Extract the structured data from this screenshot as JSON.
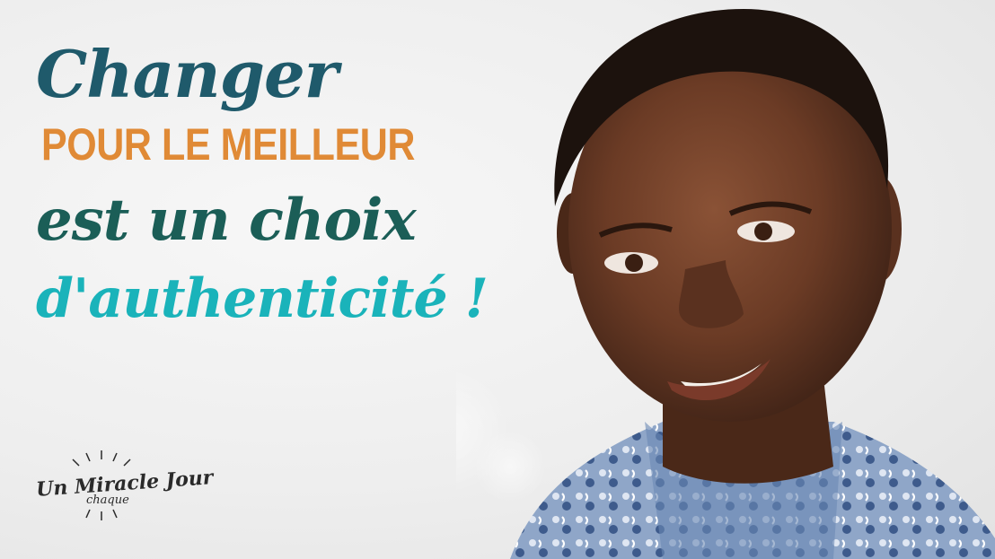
{
  "headline": {
    "line1": "Changer",
    "line2": "POUR LE MEILLEUR",
    "line3": "est un choix",
    "line4": "d'authenticité !"
  },
  "logo": {
    "main": "Un Miracle Jour",
    "sub": "chaque"
  },
  "colors": {
    "teal_dark": "#1f5a6b",
    "orange": "#e08a36",
    "green_dark": "#1b5e57",
    "turquoise": "#1ab3ba"
  }
}
